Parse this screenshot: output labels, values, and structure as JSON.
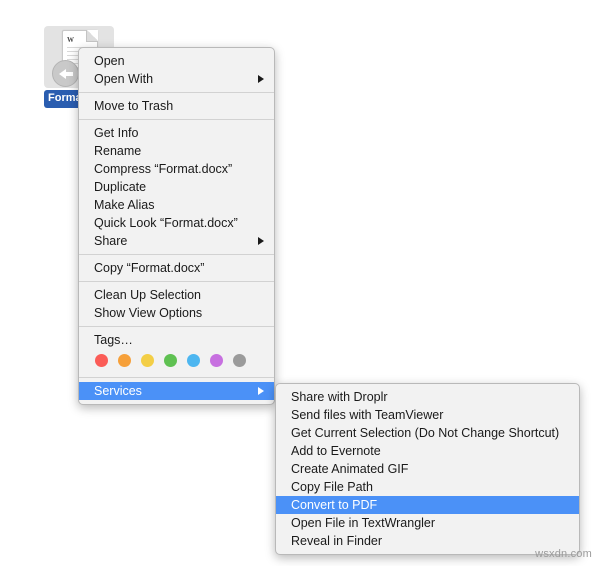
{
  "desktop": {
    "file": {
      "name_label": "Forma",
      "full_name": "Format.docx",
      "icon_mark": "W",
      "badge_icon": "back-arrow-badge"
    },
    "background_color": "#ffffff"
  },
  "context_menu": {
    "groups": [
      {
        "items": [
          {
            "label": "Open",
            "submenu": false,
            "highlighted": false
          },
          {
            "label": "Open With",
            "submenu": true,
            "highlighted": false
          }
        ]
      },
      {
        "items": [
          {
            "label": "Move to Trash",
            "submenu": false,
            "highlighted": false
          }
        ]
      },
      {
        "items": [
          {
            "label": "Get Info",
            "submenu": false,
            "highlighted": false
          },
          {
            "label": "Rename",
            "submenu": false,
            "highlighted": false
          },
          {
            "label": "Compress “Format.docx”",
            "submenu": false,
            "highlighted": false
          },
          {
            "label": "Duplicate",
            "submenu": false,
            "highlighted": false
          },
          {
            "label": "Make Alias",
            "submenu": false,
            "highlighted": false
          },
          {
            "label": "Quick Look “Format.docx”",
            "submenu": false,
            "highlighted": false
          },
          {
            "label": "Share",
            "submenu": true,
            "highlighted": false
          }
        ]
      },
      {
        "items": [
          {
            "label": "Copy “Format.docx”",
            "submenu": false,
            "highlighted": false
          }
        ]
      },
      {
        "items": [
          {
            "label": "Clean Up Selection",
            "submenu": false,
            "highlighted": false
          },
          {
            "label": "Show View Options",
            "submenu": false,
            "highlighted": false
          }
        ]
      },
      {
        "items": [
          {
            "label": "Tags…",
            "submenu": false,
            "highlighted": false
          }
        ],
        "tags": [
          {
            "name": "tag-red",
            "color": "#fb5c57"
          },
          {
            "name": "tag-orange",
            "color": "#f6a03a"
          },
          {
            "name": "tag-yellow",
            "color": "#f3ce46"
          },
          {
            "name": "tag-green",
            "color": "#5fc152"
          },
          {
            "name": "tag-blue",
            "color": "#4db6f0"
          },
          {
            "name": "tag-purple",
            "color": "#c770e0"
          },
          {
            "name": "tag-gray",
            "color": "#9b9b9b"
          }
        ]
      },
      {
        "items": [
          {
            "label": "Services",
            "submenu": true,
            "highlighted": true
          }
        ]
      }
    ]
  },
  "services_submenu": {
    "items": [
      {
        "label": "Share with Droplr",
        "highlighted": false
      },
      {
        "label": "Send files with TeamViewer",
        "highlighted": false
      },
      {
        "label": "Get Current Selection (Do Not Change Shortcut)",
        "highlighted": false
      },
      {
        "label": "Add to Evernote",
        "highlighted": false
      },
      {
        "label": "Create Animated GIF",
        "highlighted": false
      },
      {
        "label": "Copy File Path",
        "highlighted": false
      },
      {
        "label": "Convert to PDF",
        "highlighted": true
      },
      {
        "label": "Open File in TextWrangler",
        "highlighted": false
      },
      {
        "label": "Reveal in Finder",
        "highlighted": false
      }
    ]
  },
  "colors": {
    "highlight": "#4b91f7",
    "menu_background": "#f2f2f2",
    "menu_border": "#b9b9b9",
    "selection_label": "#2a5db0"
  },
  "watermark": {
    "text": "wsxdn.com"
  }
}
